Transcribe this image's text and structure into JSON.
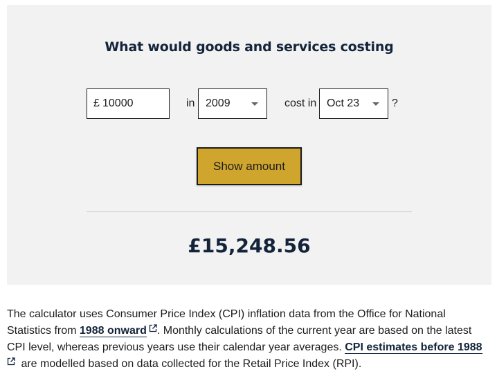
{
  "calculator": {
    "heading": "What would goods and services costing",
    "currency_symbol": "£",
    "amount_value": "10000",
    "in_label": "in",
    "year_selected": "2009",
    "cost_in_label": "cost in",
    "month_selected": "Oct 23",
    "question_mark": "?",
    "button_label": "Show amount",
    "result": "£15,248.56"
  },
  "description": {
    "part1": "The calculator uses Consumer Price Index (CPI) inflation data from the Office for National Statistics from ",
    "link1": "1988 onward",
    "part2": ". Monthly calculations of the current year are based on the latest CPI level, whereas previous years use their calendar year averages. ",
    "link2": "CPI estimates before 1988",
    "part3": " are modelled based on data collected for the Retail Price Index (RPI)."
  },
  "icons": {
    "dropdown": "caret-down-icon",
    "external_link": "external-link-icon"
  },
  "colors": {
    "panel_bg": "#f2f2f2",
    "button_bg": "#cfa52e",
    "heading": "#13243a"
  }
}
